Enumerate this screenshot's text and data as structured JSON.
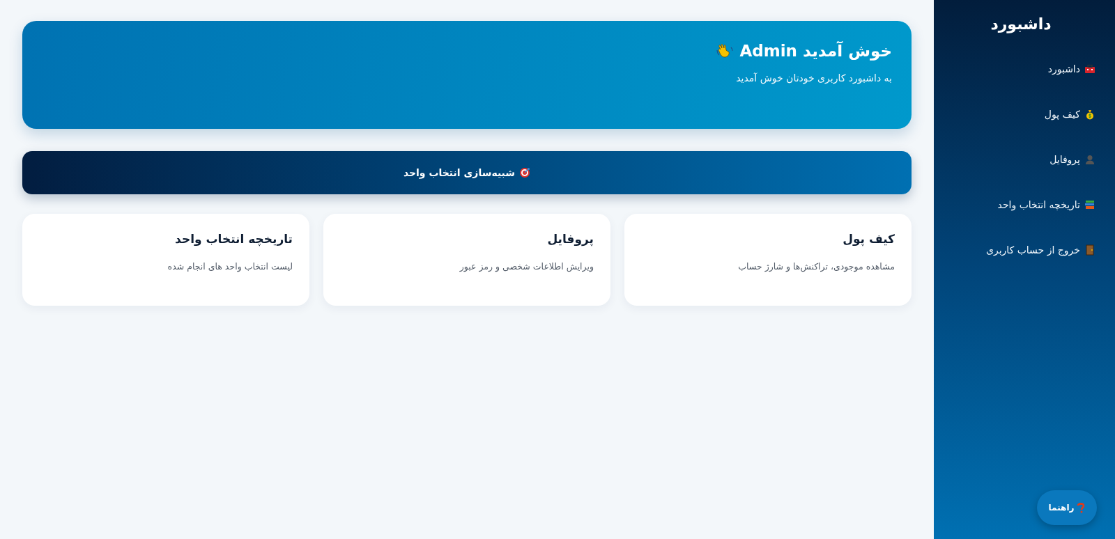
{
  "sidebar": {
    "title": "داشبورد",
    "items": [
      {
        "label": "داشبورد"
      },
      {
        "label": "کیف پول"
      },
      {
        "label": "پروفایل"
      },
      {
        "label": "تاریخچه انتخاب واحد"
      },
      {
        "label": "خروج از حساب کاربری"
      }
    ],
    "help_button": "راهنما"
  },
  "welcome": {
    "title": "خوش آمدید Admin",
    "subtitle": "به داشبورد کاربری خودتان خوش آمدید"
  },
  "simulate_button": "شبیه‌سازی انتخاب واحد",
  "cards": [
    {
      "title": "کیف پول",
      "description": "مشاهده موجودی، تراکنش‌ها و شارژ حساب"
    },
    {
      "title": "پروفایل",
      "description": "ویرایش اطلاعات شخصی و رمز عبور"
    },
    {
      "title": "تاریخچه انتخاب واحد",
      "description": "لیست انتخاب واحد های انجام شده"
    }
  ]
}
